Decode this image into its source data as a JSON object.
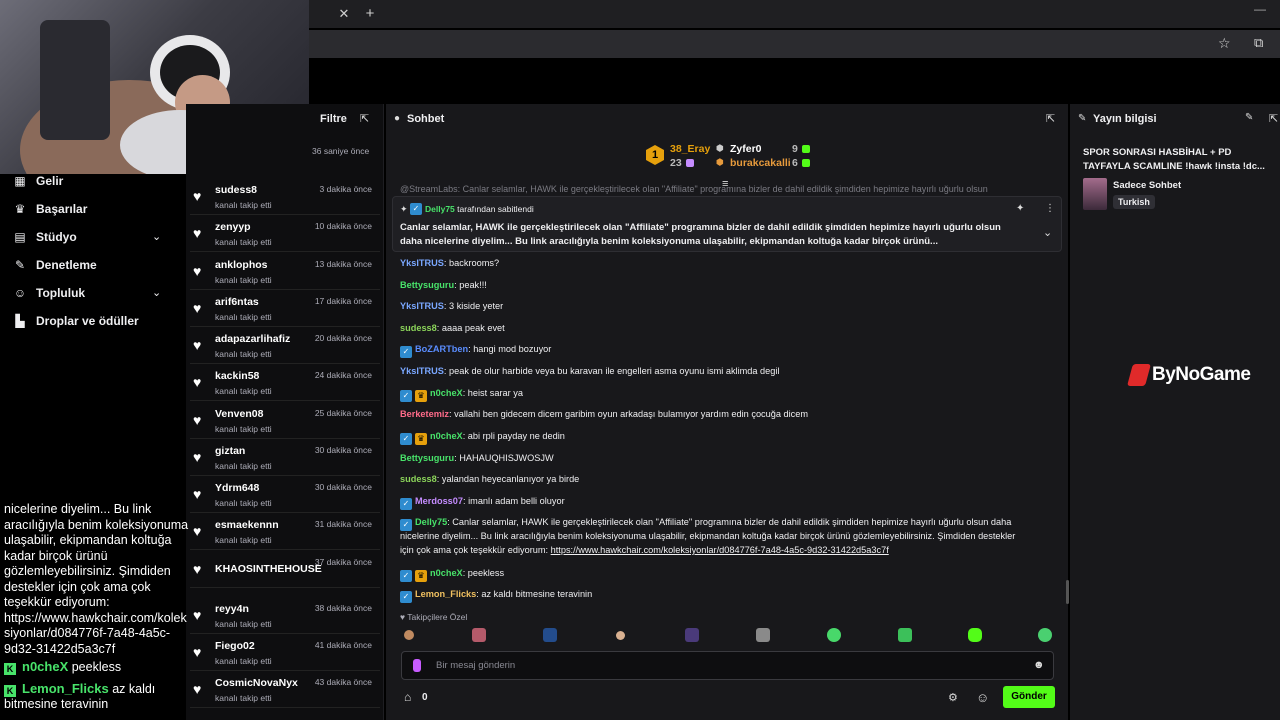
{
  "browser": {
    "tab_close": "✕",
    "new_tab": "+",
    "minimize": "—"
  },
  "nav": {
    "items": [
      {
        "label": "Gelir",
        "icon": "money-icon",
        "chevron": false
      },
      {
        "label": "Başarılar",
        "icon": "trophy-icon",
        "chevron": false
      },
      {
        "label": "Stüdyo",
        "icon": "studio-icon",
        "chevron": true
      },
      {
        "label": "Denetleme",
        "icon": "wrench-icon",
        "chevron": false
      },
      {
        "label": "Topluluk",
        "icon": "community-icon",
        "chevron": true
      },
      {
        "label": "Droplar ve ödüller",
        "icon": "drops-icon",
        "chevron": false
      }
    ]
  },
  "activity": {
    "filter_label": "Filtre",
    "first_time": "36 saniye önce",
    "items": [
      {
        "name": "sudess8",
        "sub": "kanalı takip etti",
        "time": "3 dakika önce"
      },
      {
        "name": "zenyyp",
        "sub": "kanalı takip etti",
        "time": "10 dakika önce"
      },
      {
        "name": "anklophos",
        "sub": "kanalı takip etti",
        "time": "13 dakika önce"
      },
      {
        "name": "arif6ntas",
        "sub": "kanalı takip etti",
        "time": "17 dakika önce"
      },
      {
        "name": "adapazarlihafiz",
        "sub": "kanalı takip etti",
        "time": "20 dakika önce"
      },
      {
        "name": "kackin58",
        "sub": "kanalı takip etti",
        "time": "24 dakika önce"
      },
      {
        "name": "Venven08",
        "sub": "kanalı takip etti",
        "time": "25 dakika önce"
      },
      {
        "name": "giztan",
        "sub": "kanalı takip etti",
        "time": "30 dakika önce"
      },
      {
        "name": "Ydrm648",
        "sub": "kanalı takip etti",
        "time": "30 dakika önce"
      },
      {
        "name": "esmaekennn",
        "sub": "kanalı takip etti",
        "time": "31 dakika önce"
      },
      {
        "name": "KHAOSINTHEHOUSE",
        "sub": "",
        "time": "37 dakika önce"
      },
      {
        "name": "reyy4n",
        "sub": "kanalı takip etti",
        "time": "38 dakika önce"
      },
      {
        "name": "Fiego02",
        "sub": "kanalı takip etti",
        "time": "41 dakika önce"
      },
      {
        "name": "CosmicNovaNyx",
        "sub": "kanalı takip etti",
        "time": "43 dakika önce"
      }
    ]
  },
  "overlay": {
    "text_lines": [
      "nicelerine diyelim... Bu link",
      "aracılığıyla benim koleksiyonuma",
      "ulaşabilir, ekipmandan koltuğa",
      "kadar birçok ürünü",
      "gözlemleyebilirsiniz. Şimdiden",
      "destekler için çok ama çok",
      "teşekkür ediyorum:",
      "https://www.hawkchair.com/kolek",
      "siyonlar/d084776f-7a48-4a5c-",
      "9d32-31422d5a3c7f"
    ],
    "msg1_user": "n0cheX",
    "msg1_text": "peekless",
    "msg2_user": "Lemon_Flicks",
    "msg2_text": "az kaldı",
    "msg2_cont": "bitmesine teravinin",
    "kick_badge": "K"
  },
  "chat": {
    "title": "Sohbet",
    "top_gifters": {
      "rank": "1",
      "g1_name": "38_Eray",
      "g1_count": "23",
      "g2_name": "Zyfer0",
      "g2_count": "9",
      "g3_name": "burakcakalli",
      "g3_count": "6"
    },
    "partial_top": "@StreamLabs: Canlar selamlar, HAWK ile gerçekleştirilecek olan \"Affiliate\" programına bizler de dahil edildik şimdiden hepimize hayırlı uğurlu olsun",
    "pinned": {
      "by_user": "Delly75",
      "by_suffix": "tarafından sabitlendi",
      "text1": "Canlar selamlar, HAWK ile gerçekleştirilecek olan \"Affiliate\" programına bizler de dahil edildik şimdiden hepimize hayırlı uğurlu olsun",
      "text2": "daha nicelerine diyelim... Bu link aracılığıyla benim koleksiyonuma ulaşabilir, ekipmandan koltuğa kadar birçok ürünü..."
    },
    "messages": [
      {
        "user": "YksITRUS",
        "color": "#7aa7ff",
        "text": "backrooms?"
      },
      {
        "user": "Bettysuguru",
        "color": "#48e36a",
        "text": "peak!!!"
      },
      {
        "user": "YksITRUS",
        "color": "#7aa7ff",
        "text": "3 kiside yeter"
      },
      {
        "user": "sudess8",
        "color": "#8bd35a",
        "text": "aaaa peak evet"
      },
      {
        "user": "BoZARTben",
        "color": "#5a8dff",
        "text": "hangi mod bozuyor"
      },
      {
        "user": "YksITRUS",
        "color": "#7aa7ff",
        "text": "peak de olur harbide veya bu karavan ile engelleri asma oyunu ismi aklimda degil"
      },
      {
        "user": "n0cheX",
        "color": "#48e36a",
        "text": "heist sarar ya"
      },
      {
        "user": "Berketemiz",
        "color": "#ff6b8a",
        "text": "vallahi ben gidecem dicem garibim oyun arkadaşı bulamıyor yardım edin çocuğa dicem"
      },
      {
        "user": "n0cheX",
        "color": "#48e36a",
        "text": "abi rpli payday ne dedin"
      },
      {
        "user": "Bettysuguru",
        "color": "#48e36a",
        "text": "HAHAUQHISJWOSJW"
      },
      {
        "user": "sudess8",
        "color": "#8bd35a",
        "text": "yalandan heyecanlanıyor ya birde"
      },
      {
        "user": "Merdoss07",
        "color": "#c58cff",
        "text": "imanlı adam belli oluyor"
      }
    ],
    "long_msg": {
      "user": "Delly75",
      "text1": "Canlar selamlar, HAWK ile gerçekleştirilecek olan \"Affiliate\" programına bizler de dahil edildik şimdiden hepimize hayırlı uğurlu olsun daha",
      "text2": "nicelerine diyelim... Bu link aracılığıyla benim koleksiyonuma ulaşabilir, ekipmandan koltuğa kadar birçok ürünü gözlemleyebilirsiniz. Şimdiden destekler",
      "text3": "için çok ama çok teşekkür ediyorum:",
      "link": "https://www.hawkchair.com/koleksiyonlar/d084776f-7a48-4a5c-9d32-31422d5a3c7f"
    },
    "after": [
      {
        "user": "n0cheX",
        "color": "#48e36a",
        "text": "peekless"
      },
      {
        "user": "Lemon_Flicks",
        "color": "#f0c060",
        "text": "az kaldı bitmesine teravinin"
      }
    ],
    "followers_label": "Takipçilere Özel",
    "input_placeholder": "Bir mesaj gönderin",
    "points": "0",
    "send_label": "Gönder"
  },
  "stream_info": {
    "title": "Yayın bilgisi",
    "stream_title_1": "SPOR SONRASI HASBİHAL + PD",
    "stream_title_2": "TAYFAYLA SCAMLINE !hawk !insta !dc...",
    "category": "Sadece Sohbet",
    "tag": "Turkish",
    "sponsor": "ByNoGame"
  },
  "colors": {
    "accent": "#53fc18",
    "panel": "#18181b",
    "bg": "#0e0e10"
  }
}
